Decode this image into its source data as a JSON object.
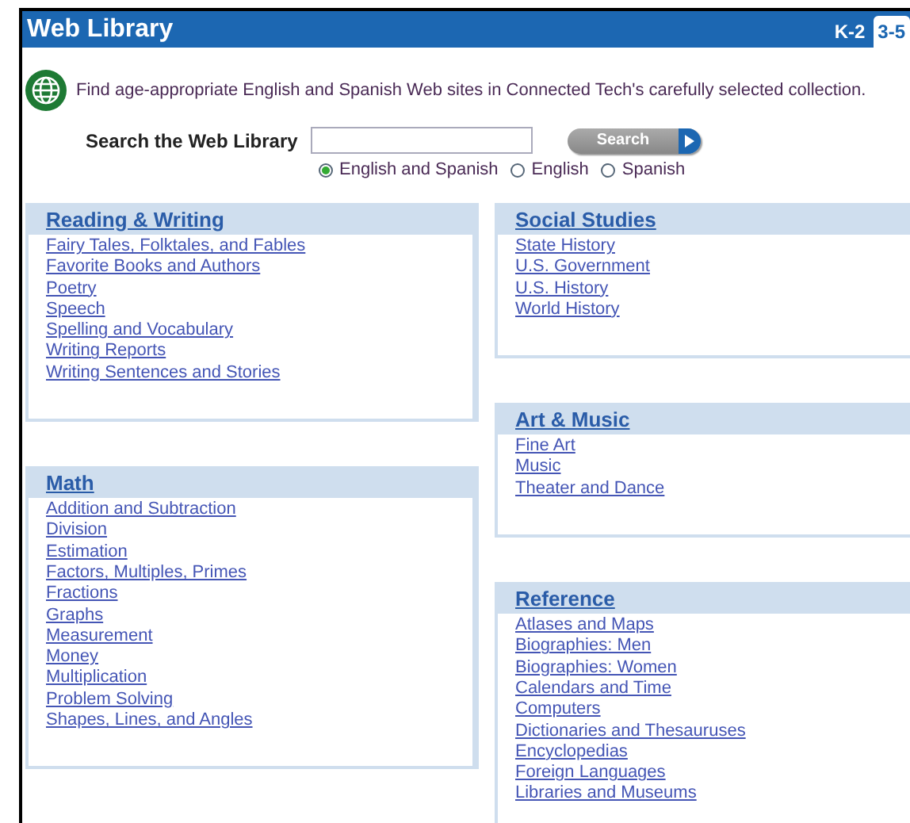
{
  "header": {
    "title": "Web Library",
    "tabs": [
      {
        "label": "K-2",
        "selected": false
      },
      {
        "label": "3-5",
        "selected": true
      }
    ]
  },
  "intro": "Find age-appropriate English and Spanish Web sites in Connected Tech's carefully selected collection.",
  "search": {
    "label": "Search the Web Library",
    "button": "Search",
    "options": [
      {
        "label": "English and Spanish",
        "selected": true
      },
      {
        "label": "English",
        "selected": false
      },
      {
        "label": "Spanish",
        "selected": false
      }
    ]
  },
  "columns": [
    {
      "panels": [
        {
          "title": "Reading & Writing",
          "links": [
            "Fairy Tales, Folktales, and Fables",
            "Favorite Books and Authors",
            "Poetry",
            "Speech",
            "Spelling and Vocabulary",
            "Writing Reports",
            "Writing Sentences and Stories"
          ]
        },
        {
          "title": "Math",
          "links": [
            "Addition and Subtraction",
            "Division",
            "Estimation",
            "Factors, Multiples, Primes",
            "Fractions",
            "Graphs",
            "Measurement",
            "Money",
            "Multiplication",
            "Problem Solving",
            "Shapes, Lines, and Angles"
          ]
        }
      ]
    },
    {
      "panels": [
        {
          "title": "Social Studies",
          "links": [
            "State History",
            "U.S. Government",
            "U.S. History",
            "World History"
          ]
        },
        {
          "title": "Art & Music",
          "links": [
            "Fine Art",
            "Music",
            "Theater and Dance"
          ]
        },
        {
          "title": "Reference",
          "links": [
            "Atlases and Maps",
            "Biographies: Men",
            "Biographies: Women",
            "Calendars and Time",
            "Computers",
            "Dictionaries and Thesauruses",
            "Encyclopedias",
            "Foreign Languages",
            "Libraries and Museums"
          ]
        }
      ]
    }
  ]
}
